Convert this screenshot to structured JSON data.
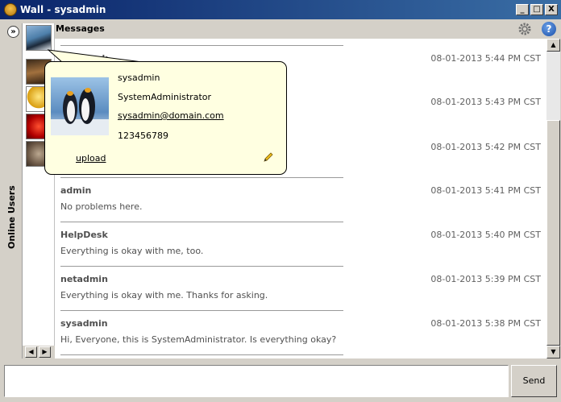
{
  "window": {
    "title": "Wall - sysadmin",
    "controls": [
      "_",
      "□",
      "X"
    ]
  },
  "sidebar": {
    "expand_glyph": "»",
    "label": "Online Users"
  },
  "messages_panel": {
    "title": "Messages"
  },
  "messages": [
    {
      "author": "HelpDesk",
      "time": "08-01-2013 5:44 PM CST",
      "body": ""
    },
    {
      "author": "",
      "time": "08-01-2013 5:43 PM CST",
      "body": ""
    },
    {
      "author": "",
      "time": "08-01-2013 5:42 PM CST",
      "body": ""
    },
    {
      "author": "admin",
      "time": "08-01-2013 5:41 PM CST",
      "body": "No problems here."
    },
    {
      "author": "HelpDesk",
      "time": "08-01-2013 5:40 PM CST",
      "body": "Everything is okay with me, too."
    },
    {
      "author": "netadmin",
      "time": "08-01-2013 5:39 PM CST",
      "body": "Everything is okay with me. Thanks for asking."
    },
    {
      "author": "sysadmin",
      "time": "08-01-2013 5:38 PM CST",
      "body": "Hi, Everyone, this is SystemAdministrator. Is everything okay?"
    }
  ],
  "profile_popup": {
    "username": "sysadmin",
    "full_name": "SystemAdministrator",
    "email": "sysadmin@domain.com",
    "phone": "123456789",
    "upload_label": "upload"
  },
  "composer": {
    "send_label": "Send",
    "value": ""
  },
  "icons": {
    "gear": "gear-icon",
    "help": "help-icon",
    "pencil": "pencil-icon"
  }
}
